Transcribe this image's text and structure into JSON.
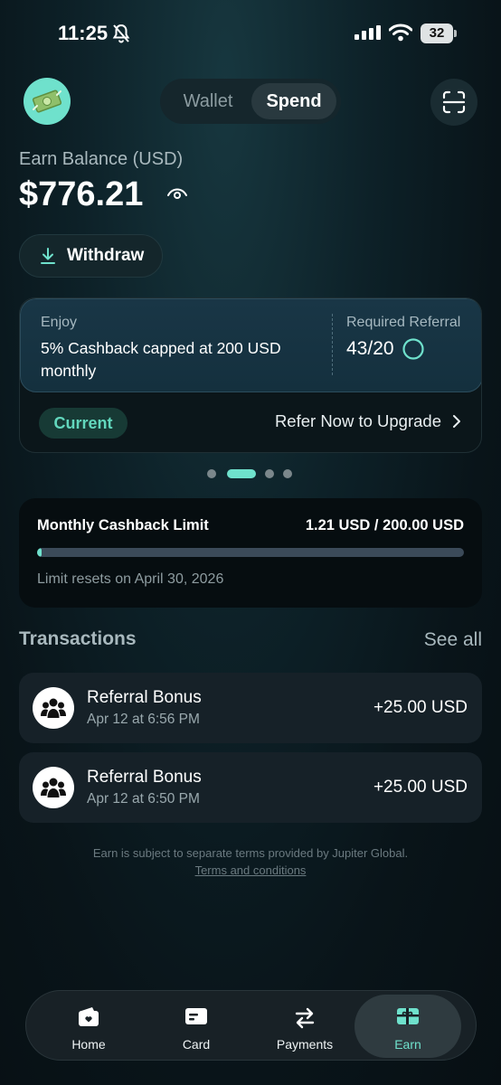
{
  "status_bar": {
    "time": "11:25",
    "battery": "32"
  },
  "header": {
    "tabs": [
      {
        "label": "Wallet",
        "selected": false
      },
      {
        "label": "Spend",
        "selected": true
      }
    ]
  },
  "balance": {
    "label": "Earn Balance (USD)",
    "value": "$776.21",
    "withdraw_label": "Withdraw"
  },
  "promo": {
    "enjoy_label": "Enjoy",
    "description": "5% Cashback capped at 200 USD monthly",
    "required_label": "Required Referral",
    "required_value": "43/20",
    "badge": "Current",
    "cta": "Refer Now to Upgrade",
    "carousel_index": 1,
    "carousel_count": 4
  },
  "limit": {
    "title": "Monthly Cashback Limit",
    "value": "1.21 USD / 200.00 USD",
    "progress_fraction": 0.006,
    "reset_text": "Limit resets on April 30, 2026"
  },
  "transactions": {
    "header": "Transactions",
    "see_all": "See all",
    "items": [
      {
        "title": "Referral Bonus",
        "date": "Apr 12 at 6:56 PM",
        "amount": "+25.00 USD"
      },
      {
        "title": "Referral Bonus",
        "date": "Apr 12 at 6:50 PM",
        "amount": "+25.00 USD"
      }
    ]
  },
  "disclaimer": {
    "text": "Earn is subject to separate terms provided by Jupiter Global. ",
    "link": "Terms and conditions"
  },
  "nav": [
    {
      "label": "Home",
      "icon": "wallet-heart-icon",
      "active": false
    },
    {
      "label": "Card",
      "icon": "card-icon",
      "active": false
    },
    {
      "label": "Payments",
      "icon": "transfer-arrows-icon",
      "active": false
    },
    {
      "label": "Earn",
      "icon": "gift-card-icon",
      "active": true
    }
  ],
  "colors": {
    "accent": "#6fe1cc",
    "background": "#0d2128",
    "progress_track": "#3b4a59"
  }
}
